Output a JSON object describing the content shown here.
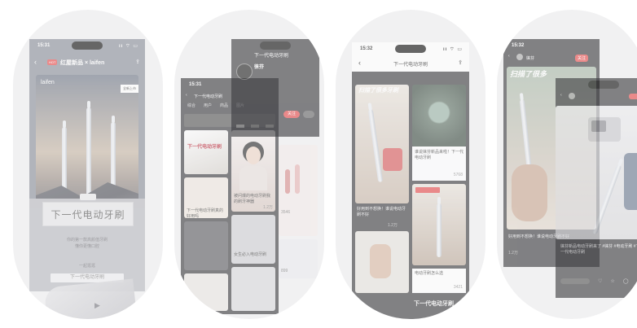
{
  "screen1": {
    "time": "15:31",
    "status_icons": "ıı ⌔ ▭",
    "header_brand": "红屋新品 × laifen",
    "search_tag": "HOT",
    "card_brand": "laifen",
    "card_badge": "全新上市",
    "hero_title": "下一代电动牙刷",
    "subtitle_line1": "你的第一款高颜值牙刷",
    "subtitle_line2": "懂你更懂口腔",
    "bottom_hint": "一起逛逛",
    "search_bar": "下一代电动牙刷"
  },
  "screen2": {
    "time": "15:31",
    "header_title": "下一代电动牙刷",
    "tabs": [
      "综合",
      "用户",
      "商品",
      "图片"
    ],
    "filter": "筛选",
    "feed_banner": "下一代电动牙刷",
    "profile_name": "徕芬",
    "profile_title": "下一代电动牙刷",
    "follow_label": "关注",
    "post_captions": [
      "被问爆的电动牙刷我的刷牙神器",
      "下一代电动牙刷真的好用吗",
      "女生必入电动牙刷"
    ],
    "like_counts": [
      "1.2万",
      "3546",
      "899"
    ]
  },
  "screen3": {
    "time": "15:32",
    "status_icons": "ıı ⌔ ▭",
    "header_title": "下一代电动牙刷",
    "tile_heading": "扫描了很多牙刷",
    "captions": [
      "好用到不想换！谁说电动牙刷不好",
      "谁说徕芬新品来啦！下一代电动牙刷",
      "电动牙刷怎么选"
    ],
    "like_counts": [
      "1.2万",
      "5768",
      "3421"
    ],
    "banner_text": "下一代电动牙刷"
  },
  "screen4": {
    "time": "15:32",
    "status_icons": "ıı ⌔ ▭",
    "back_title": "徕芬",
    "follow_label": "关注",
    "heading": "扫描了很多",
    "caption_left": "好用到不想换！谁说电动牙刷不好",
    "caption_right": "徕芬新品电动牙刷来了 #徕芬 #电动牙刷 #下一代电动牙刷",
    "like_count": "1.2万"
  },
  "colors": {
    "accent_red": "#e54b4b",
    "dark_ui": "#3c3c40",
    "frame_gray": "#f1f1f2"
  }
}
